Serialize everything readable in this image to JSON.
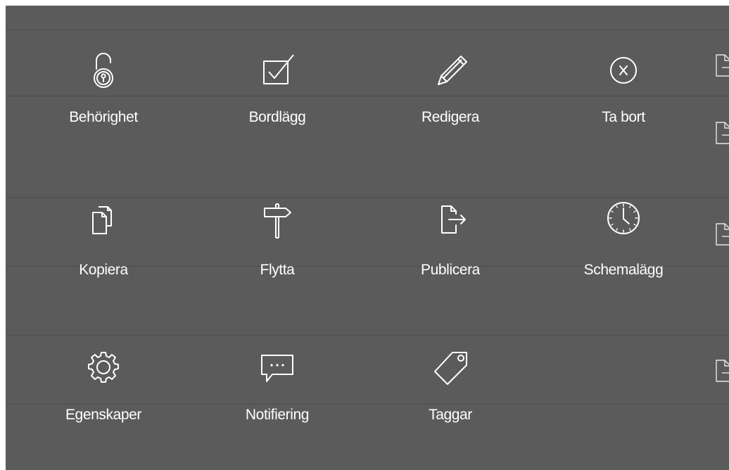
{
  "actions": [
    {
      "id": "behorighet",
      "label": "Behörighet",
      "icon": "unlock-icon"
    },
    {
      "id": "bordlagg",
      "label": "Bordlägg",
      "icon": "checkbox-icon"
    },
    {
      "id": "redigera",
      "label": "Redigera",
      "icon": "pencil-icon"
    },
    {
      "id": "ta-bort",
      "label": "Ta bort",
      "icon": "delete-circle-icon"
    },
    {
      "id": "kopiera",
      "label": "Kopiera",
      "icon": "copy-icon"
    },
    {
      "id": "flytta",
      "label": "Flytta",
      "icon": "signpost-icon"
    },
    {
      "id": "publicera",
      "label": "Publicera",
      "icon": "publish-icon"
    },
    {
      "id": "schemalagg",
      "label": "Schemalägg",
      "icon": "clock-icon"
    },
    {
      "id": "egenskaper",
      "label": "Egenskaper",
      "icon": "gear-icon"
    },
    {
      "id": "notifiering",
      "label": "Notifiering",
      "icon": "speech-bubble-icon"
    },
    {
      "id": "taggar",
      "label": "Taggar",
      "icon": "tag-icon"
    }
  ],
  "colors": {
    "panel_background": "#5b5b5b",
    "icon_stroke": "#ffffff",
    "label_text": "#ffffff"
  }
}
